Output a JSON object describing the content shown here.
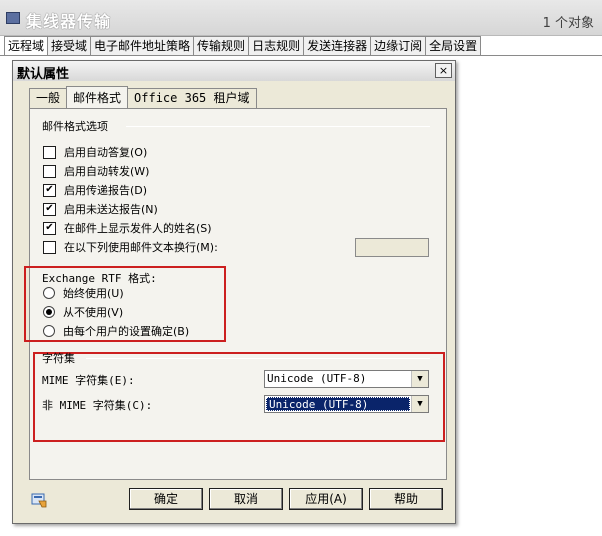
{
  "window": {
    "title": "集线器传输",
    "count": "1 个对象"
  },
  "tabs": [
    {
      "label": "远程域"
    },
    {
      "label": "接受域"
    },
    {
      "label": "电子邮件地址策略"
    },
    {
      "label": "传输规则"
    },
    {
      "label": "日志规则"
    },
    {
      "label": "发送连接器"
    },
    {
      "label": "边缘订阅"
    },
    {
      "label": "全局设置"
    }
  ],
  "dialog": {
    "title": "默认属性",
    "close": "×",
    "tabs": [
      {
        "label": "一般"
      },
      {
        "label": "邮件格式"
      },
      {
        "label": "Office 365 租户域"
      }
    ],
    "options_label": "邮件格式选项",
    "checkboxes": [
      {
        "label": "启用自动答复(O)",
        "checked": false
      },
      {
        "label": "启用自动转发(W)",
        "checked": false
      },
      {
        "label": "启用传递报告(D)",
        "checked": true
      },
      {
        "label": "启用未送达报告(N)",
        "checked": true
      },
      {
        "label": "在邮件上显示发件人的姓名(S)",
        "checked": true
      },
      {
        "label": "在以下列使用邮件文本换行(M):",
        "checked": false
      }
    ],
    "rtf_label": "Exchange RTF 格式:",
    "rtf_options": [
      {
        "label": "始终使用(U)",
        "selected": false
      },
      {
        "label": "从不使用(V)",
        "selected": true
      },
      {
        "label": "由每个用户的设置确定(B)",
        "selected": false
      }
    ],
    "charset_label": "字符集",
    "mime_label": "MIME 字符集(E):",
    "mime_value": "Unicode (UTF-8)",
    "nonmime_label": "非 MIME 字符集(C):",
    "nonmime_value": "Unicode (UTF-8)",
    "buttons": {
      "ok": "确定",
      "cancel": "取消",
      "apply": "应用(A)",
      "help": "帮助"
    }
  },
  "colors": {
    "highlight_box": "#cc1f1f",
    "selection": "#0a246a",
    "dialog_bg": "#ece9d8"
  }
}
